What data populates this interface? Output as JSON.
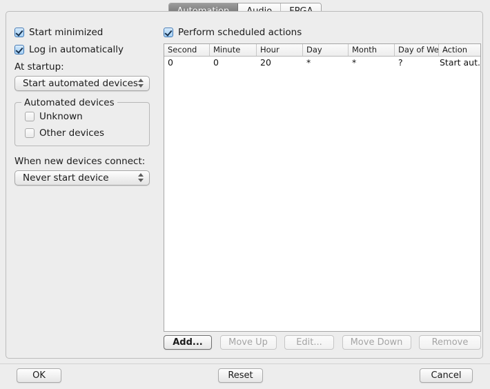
{
  "tabs": [
    {
      "label": "Automation",
      "active": true
    },
    {
      "label": "Audio",
      "active": false
    },
    {
      "label": "FPGA",
      "active": false
    }
  ],
  "left": {
    "start_minimized": {
      "label": "Start minimized",
      "checked": true
    },
    "log_in_automatically": {
      "label": "Log in automatically",
      "checked": true
    },
    "at_startup_label": "At startup:",
    "at_startup_value": "Start automated devices",
    "automated_devices_group": {
      "title": "Automated devices",
      "unknown": {
        "label": "Unknown",
        "checked": false
      },
      "other_devices": {
        "label": "Other devices",
        "checked": false
      }
    },
    "when_new_devices_label": "When new devices connect:",
    "when_new_devices_value": "Never start device"
  },
  "right": {
    "perform_scheduled_actions": {
      "label": "Perform scheduled actions",
      "checked": true
    },
    "table": {
      "columns": [
        "Second",
        "Minute",
        "Hour",
        "Day",
        "Month",
        "Day of We...",
        "Action"
      ],
      "rows": [
        [
          "0",
          "0",
          "20",
          "*",
          "*",
          "?",
          "Start aut..."
        ]
      ]
    },
    "buttons": {
      "add": {
        "label": "Add...",
        "enabled": true
      },
      "move_up": {
        "label": "Move Up",
        "enabled": false
      },
      "edit": {
        "label": "Edit...",
        "enabled": false
      },
      "move_down": {
        "label": "Move Down",
        "enabled": false
      },
      "remove": {
        "label": "Remove",
        "enabled": false
      }
    }
  },
  "footer": {
    "ok": "OK",
    "reset": "Reset",
    "cancel": "Cancel"
  }
}
